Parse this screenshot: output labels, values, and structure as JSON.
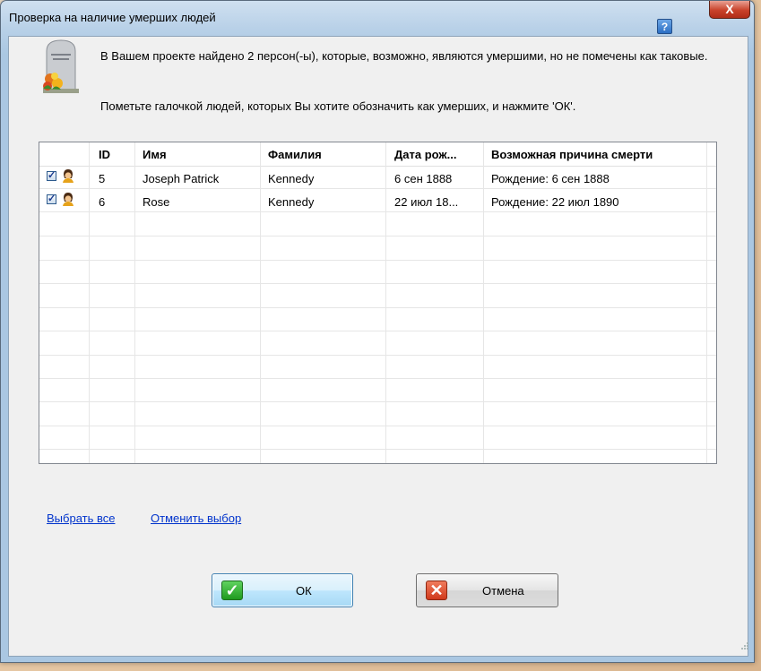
{
  "window": {
    "title": "Проверка на наличие умерших людей",
    "help_label": "?",
    "close_label": "X"
  },
  "message": {
    "line1": "В Вашем проекте найдено 2 персон(-ы), которые, возможно, являются умершими, но не помечены как таковые.",
    "line2": "Пометьте галочкой людей, которых Вы хотите обозначить как умерших, и нажмите 'ОК'."
  },
  "table": {
    "columns": [
      "ID",
      "Имя",
      "Фамилия",
      "Дата рож...",
      "Возможная причина смерти"
    ],
    "rows": [
      {
        "checked": true,
        "id": "5",
        "first_name": "Joseph Patrick",
        "last_name": "Kennedy",
        "birth": "6 сен 1888",
        "reason": "Рождение: 6 сен 1888"
      },
      {
        "checked": true,
        "id": "6",
        "first_name": "Rose",
        "last_name": "Kennedy",
        "birth": "22 июл 18...",
        "reason": "Рождение: 22 июл 1890"
      }
    ]
  },
  "links": {
    "select_all": "Выбрать все",
    "deselect": "Отменить выбор"
  },
  "buttons": {
    "ok": "ОК",
    "cancel": "Отмена"
  },
  "colors": {
    "link": "#0033cc",
    "ok_icon": "#1f9a1f",
    "cancel_icon": "#d0391b"
  },
  "icons": {
    "header": "tombstone-flowers-icon",
    "row": "person-icon",
    "ok": "check-icon",
    "cancel": "x-icon"
  }
}
